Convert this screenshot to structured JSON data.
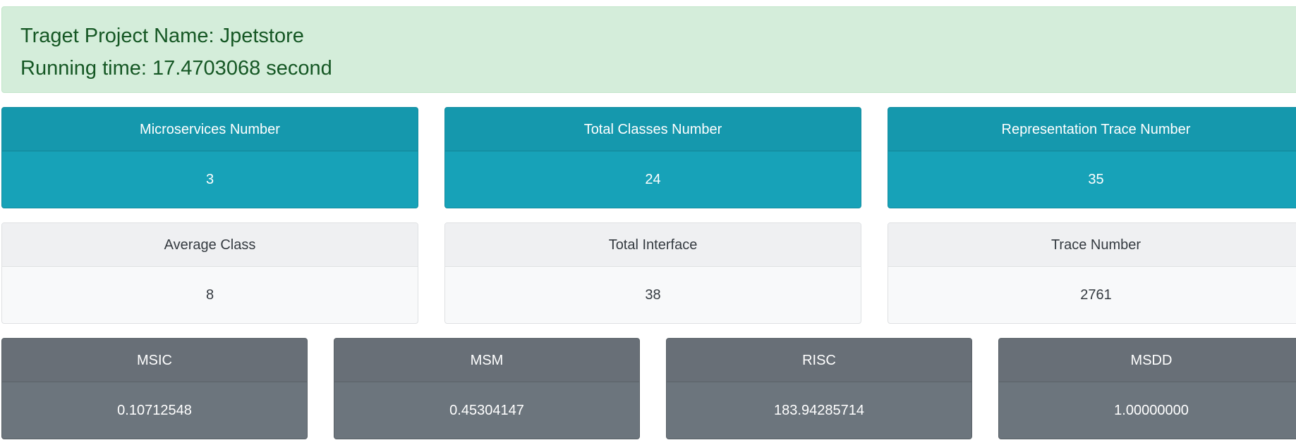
{
  "summary": {
    "project_line": "Traget Project Name: Jpetstore",
    "time_line": "Running time: 17.4703068 second"
  },
  "row1": [
    {
      "title": "Microservices Number",
      "value": "3"
    },
    {
      "title": "Total Classes Number",
      "value": "24"
    },
    {
      "title": "Representation Trace Number",
      "value": "35"
    }
  ],
  "row2": [
    {
      "title": "Average Class",
      "value": "8"
    },
    {
      "title": "Total Interface",
      "value": "38"
    },
    {
      "title": "Trace Number",
      "value": "2761"
    }
  ],
  "row3": [
    {
      "title": "MSIC",
      "value": "0.10712548"
    },
    {
      "title": "MSM",
      "value": "0.45304147"
    },
    {
      "title": "RISC",
      "value": "183.94285714"
    },
    {
      "title": "MSDD",
      "value": "1.00000000"
    }
  ],
  "colors": {
    "info": "#17a2b8",
    "light": "#f8f9fa",
    "secondary": "#6c757d",
    "success_bg": "#d4edda",
    "success_text": "#155724"
  }
}
